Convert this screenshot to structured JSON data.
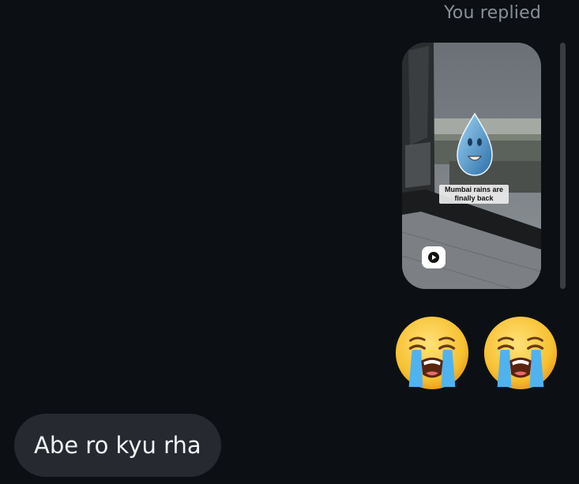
{
  "header": {
    "reply_status": "You replied"
  },
  "shared_reel": {
    "caption_line1": "Mumbai rains are",
    "caption_line2": "finally back",
    "play_icon": "play-icon"
  },
  "reaction_emojis": [
    {
      "icon": "loudly-crying-face-icon"
    },
    {
      "icon": "loudly-crying-face-icon"
    }
  ],
  "incoming_message": {
    "text": "Abe ro kyu rha"
  },
  "colors": {
    "background": "#0c1014",
    "bubble": "#262a30",
    "meta_text": "#8a8f96"
  }
}
